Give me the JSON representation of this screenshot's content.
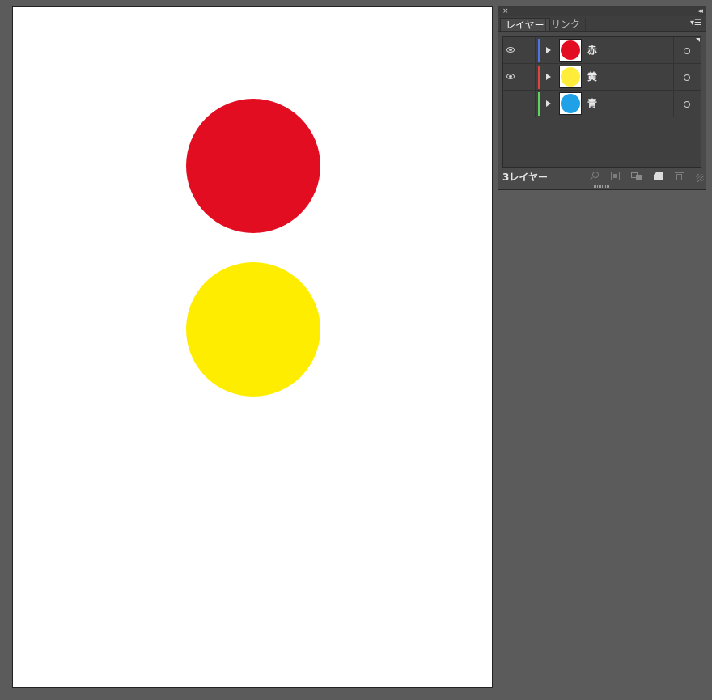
{
  "canvas": {
    "shapes": [
      {
        "name": "red-circle",
        "color": "#e30d22"
      },
      {
        "name": "yellow-circle",
        "color": "#ffed00"
      }
    ]
  },
  "panel": {
    "close_glyph": "×",
    "collapse_glyph": "◂◂",
    "menu_glyph": "▾☰",
    "tabs": [
      {
        "label": "レイヤー",
        "active": true
      },
      {
        "label": "リンク",
        "active": false
      }
    ],
    "layers": [
      {
        "name": "赤",
        "visible": true,
        "color_bar": "#4f74e6",
        "thumb_color": "#e30d22"
      },
      {
        "name": "黄",
        "visible": true,
        "color_bar": "#e0453c",
        "thumb_color": "#ffed3a"
      },
      {
        "name": "青",
        "visible": false,
        "color_bar": "#5fd35f",
        "thumb_color": "#1ea1e6"
      }
    ],
    "footer": {
      "layer_count": "3レイヤー",
      "icons": [
        "search-icon",
        "clipping-mask-icon",
        "new-sublayer-icon",
        "new-layer-icon",
        "trash-icon"
      ]
    }
  }
}
